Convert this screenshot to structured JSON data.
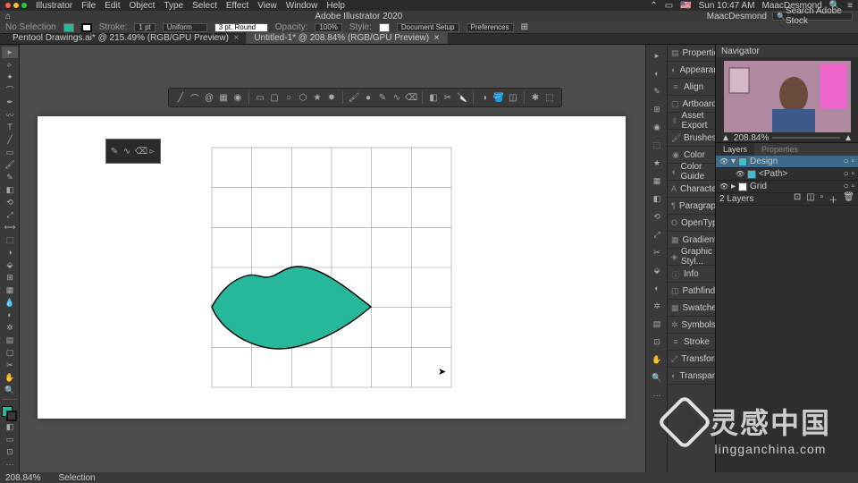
{
  "mac": {
    "apps": [
      "Illustrator",
      "File",
      "Edit",
      "Object",
      "Type",
      "Select",
      "Effect",
      "View",
      "Window",
      "Help"
    ],
    "right": {
      "time": "Sun 10:47 AM",
      "user": "MaacDesmond"
    }
  },
  "title": {
    "center": "Adobe Illustrator 2020",
    "user": "MaacDesmond",
    "search_placeholder": "Search Adobe Stock"
  },
  "ctrl": {
    "nosel": "No Selection",
    "stroke": "Stroke:",
    "stroke_w": "1 pt",
    "uniform": "Uniform",
    "round": "3 pt. Round",
    "opacity": "Opacity:",
    "opacity_v": "100%",
    "style": "Style:",
    "docsetup": "Document Setup",
    "prefs": "Preferences"
  },
  "tabs": {
    "a": "Pentool Drawings.ai* @ 215.49% (RGB/GPU Preview)",
    "b": "Untitled-1* @ 208.84% (RGB/GPU Preview)"
  },
  "panels": [
    "Properties",
    "Appearance",
    "Align",
    "Artboards",
    "Asset Export",
    "Brushes",
    "Color",
    "Color Guide",
    "Character",
    "Paragraph",
    "OpenType",
    "Gradient",
    "Graphic Styl...",
    "Info",
    "Pathfinder",
    "Swatches",
    "Symbols",
    "Stroke",
    "Transform",
    "Transparency"
  ],
  "nav": {
    "title": "Navigator",
    "zoom": "208.84%"
  },
  "layersPanel": {
    "tabs": [
      "Layers",
      "Properties"
    ],
    "rows": [
      {
        "name": "Design",
        "color": "#4bc",
        "sel": true,
        "indent": 0
      },
      {
        "name": "<Path>",
        "color": "#4bc",
        "sel": false,
        "indent": 1
      },
      {
        "name": "Grid",
        "color": "#fff",
        "sel": false,
        "indent": 0
      }
    ],
    "footer": "2 Layers"
  },
  "status": {
    "zoom": "208.84%",
    "tool": "Selection"
  },
  "colors": {
    "shape_fill": "#27b89c",
    "shape_stroke": "#000"
  },
  "watermark": {
    "cn": "灵感中国",
    "en": "lingganchina.com"
  }
}
